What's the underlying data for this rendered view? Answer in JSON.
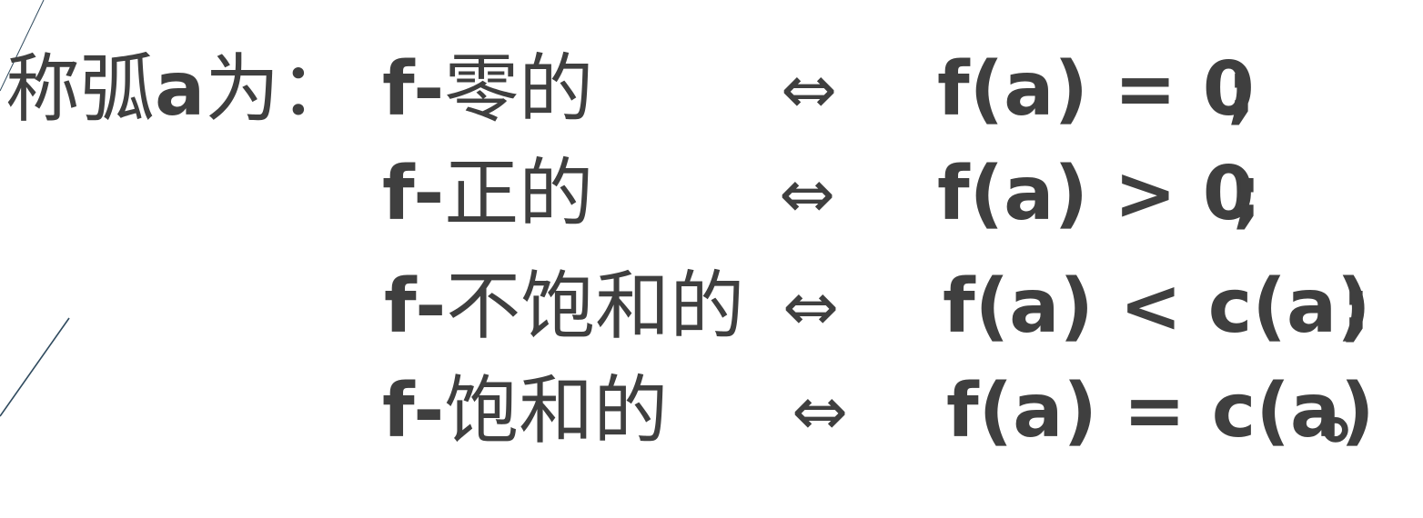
{
  "lead": {
    "text_before": "称弧",
    "variable": "a",
    "text_after": "为："
  },
  "rows": [
    {
      "term_prefix": "f-",
      "term": "零的",
      "iff": "⇔",
      "formula": "f(a) = 0",
      "punct": ";"
    },
    {
      "term_prefix": "f-",
      "term": "正的",
      "iff": "⇔",
      "formula": "f(a) > 0",
      "punct": ";"
    },
    {
      "term_prefix": "f-",
      "term": "不饱和的",
      "iff": "⇔",
      "formula": "f(a) < c(a)",
      "punct": ";"
    },
    {
      "term_prefix": "f-",
      "term": "饱和的",
      "iff": "⇔",
      "formula": "f(a) = c(a)",
      "punct": "。"
    }
  ],
  "colors": {
    "text": "#3f3f3f",
    "decor_line": "#2f4a5e"
  }
}
